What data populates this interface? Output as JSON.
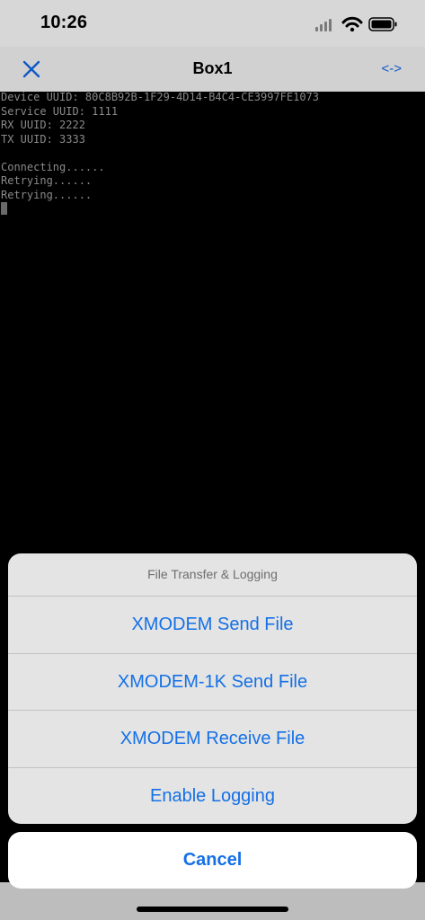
{
  "status_bar": {
    "time": "10:26",
    "icons": [
      "signal-icon",
      "wifi-icon",
      "battery-icon"
    ]
  },
  "nav": {
    "close_icon": "close-icon",
    "title": "Box1",
    "toggle_label": "<->"
  },
  "terminal": {
    "lines": [
      "Device UUID: 80C8B92B-1F29-4D14-B4C4-CE3997FE1073",
      "Service UUID: 1111",
      "RX UUID: 2222",
      "TX UUID: 3333",
      "",
      "Connecting......",
      "Retrying......",
      "Retrying......"
    ]
  },
  "action_sheet": {
    "title": "File Transfer & Logging",
    "actions": [
      "XMODEM Send File",
      "XMODEM-1K Send File",
      "XMODEM Receive File",
      "Enable Logging"
    ],
    "cancel_label": "Cancel"
  },
  "colors": {
    "accent": "#1470e6",
    "terminal_text": "#8a8a8a",
    "terminal_background": "#000000"
  }
}
